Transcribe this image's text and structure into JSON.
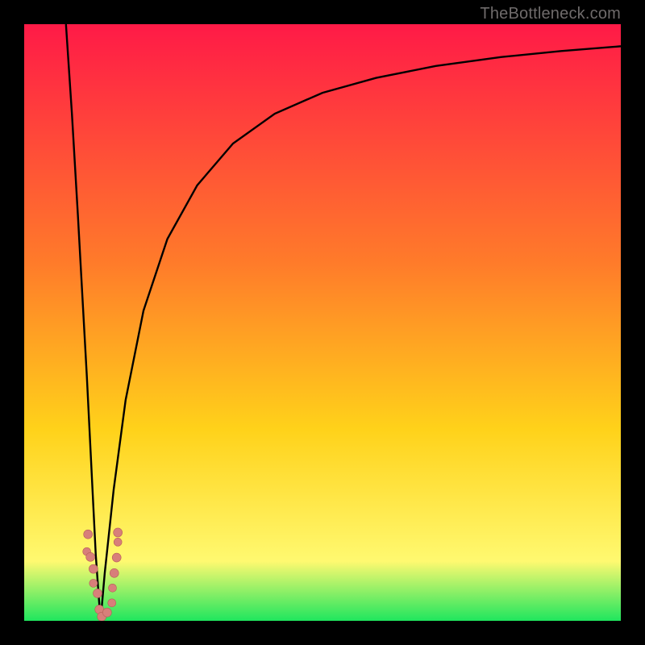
{
  "attribution": "TheBottleneck.com",
  "colors": {
    "gradient_top": "#ff1a47",
    "gradient_mid1": "#ff7b2a",
    "gradient_mid2": "#ffd21a",
    "gradient_mid3": "#fff970",
    "gradient_bottom": "#1fe65e",
    "curve": "#000000",
    "marker_fill": "#d87f7a",
    "marker_stroke": "#b85f58"
  },
  "chart_data": {
    "type": "line",
    "title": "",
    "xlabel": "",
    "ylabel": "",
    "xlim": [
      0,
      100
    ],
    "ylim": [
      0,
      100
    ],
    "series": [
      {
        "name": "left-branch",
        "x": [
          7.0,
          8.0,
          9.0,
          10.0,
          10.5,
          11.0,
          11.5,
          12.0,
          12.5,
          12.8
        ],
        "y": [
          100,
          85,
          68,
          50,
          41,
          31,
          21,
          11,
          4,
          0
        ]
      },
      {
        "name": "right-branch",
        "x": [
          12.8,
          13.5,
          15.0,
          17.0,
          20.0,
          24.0,
          29.0,
          35.0,
          42.0,
          50.0,
          59.0,
          69.0,
          80.0,
          90.0,
          100.0
        ],
        "y": [
          0,
          8,
          22,
          37,
          52,
          64,
          73,
          80,
          85,
          88.5,
          91,
          93,
          94.5,
          95.5,
          96.3
        ]
      }
    ],
    "markers": [
      {
        "x": 10.7,
        "y": 14.5,
        "r": 5.5
      },
      {
        "x": 10.5,
        "y": 11.6,
        "r": 5.0
      },
      {
        "x": 11.1,
        "y": 10.7,
        "r": 5.5
      },
      {
        "x": 11.6,
        "y": 8.7,
        "r": 5.5
      },
      {
        "x": 11.6,
        "y": 6.3,
        "r": 5.0
      },
      {
        "x": 12.3,
        "y": 4.6,
        "r": 5.5
      },
      {
        "x": 12.6,
        "y": 1.9,
        "r": 5.5
      },
      {
        "x": 13.0,
        "y": 0.7,
        "r": 5.5
      },
      {
        "x": 13.9,
        "y": 1.4,
        "r": 5.5
      },
      {
        "x": 14.7,
        "y": 3.0,
        "r": 5.0
      },
      {
        "x": 14.8,
        "y": 5.5,
        "r": 5.0
      },
      {
        "x": 15.1,
        "y": 8.0,
        "r": 5.5
      },
      {
        "x": 15.5,
        "y": 10.6,
        "r": 5.5
      },
      {
        "x": 15.7,
        "y": 13.2,
        "r": 5.0
      },
      {
        "x": 15.7,
        "y": 14.8,
        "r": 5.5
      }
    ]
  }
}
